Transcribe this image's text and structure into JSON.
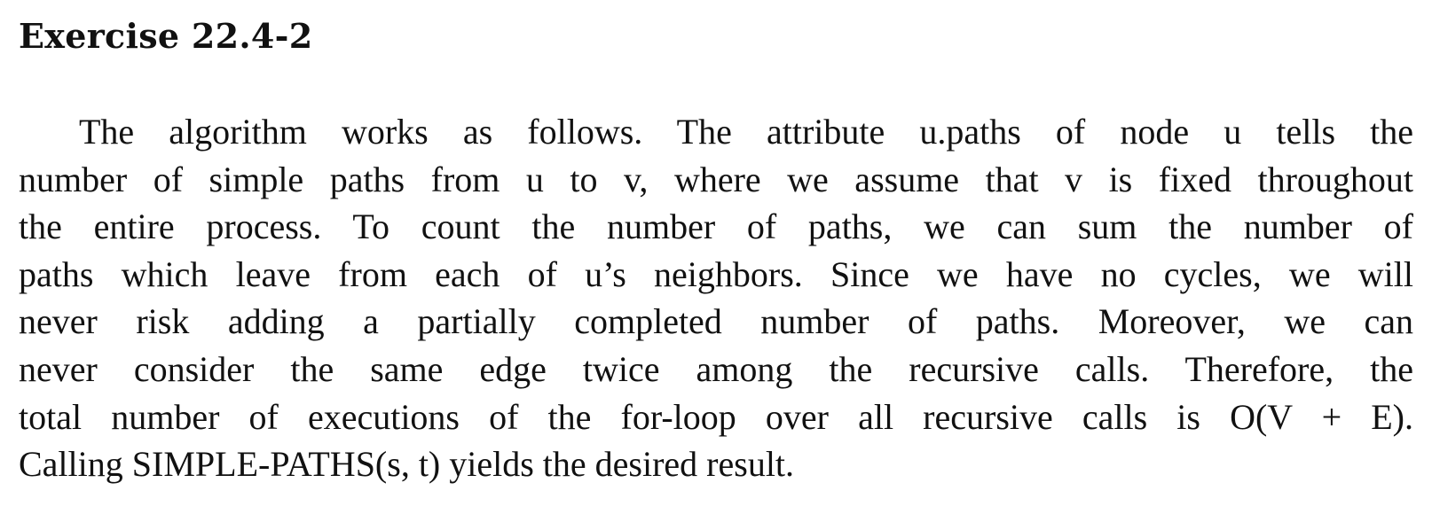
{
  "exercise": {
    "title": "Exercise 22.4-2",
    "lines": [
      "The algorithm works as follows. The attribute u.paths of node u tells the",
      "number of simple paths from u to v, where we assume that v is fixed throughout",
      "the entire process. To count the number of paths, we can sum the number of",
      "paths which leave from each of u’s neighbors. Since we have no cycles, we will",
      "never risk adding a partially completed number of paths. Moreover, we can",
      "never consider the same edge twice among the recursive calls. Therefore, the",
      "total number of executions of the for-loop over all recursive calls is O(V + E).",
      "Calling SIMPLE-PATHS(s, t) yields the desired result."
    ]
  }
}
